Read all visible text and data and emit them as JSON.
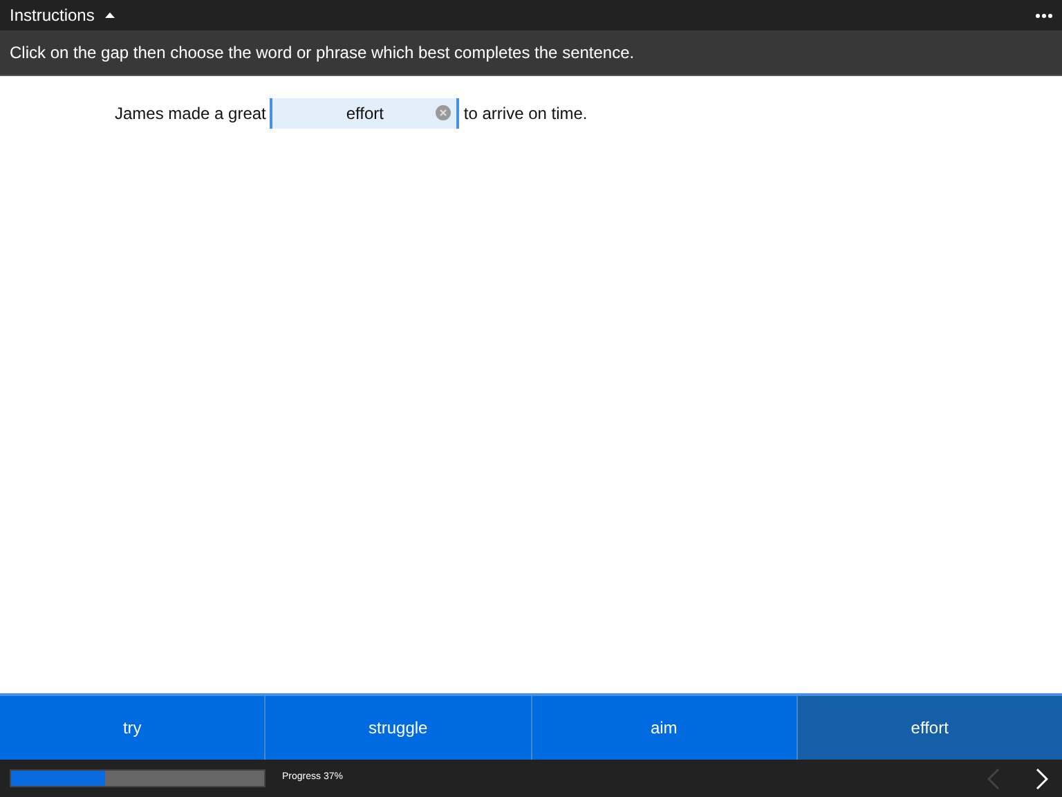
{
  "header": {
    "title": "Instructions",
    "expanded": true
  },
  "instructions": "Click on the gap then choose the word or phrase which best completes the sentence.",
  "sentence": {
    "before": "James made a great",
    "answer": "effort",
    "after": "to arrive on time."
  },
  "options": [
    {
      "label": "try",
      "selected": false
    },
    {
      "label": "struggle",
      "selected": false
    },
    {
      "label": "aim",
      "selected": false
    },
    {
      "label": "effort",
      "selected": true
    }
  ],
  "footer": {
    "progress": {
      "level": 0.37,
      "label": "Progress 37%"
    },
    "prev_disabled": true,
    "next_disabled": false
  }
}
